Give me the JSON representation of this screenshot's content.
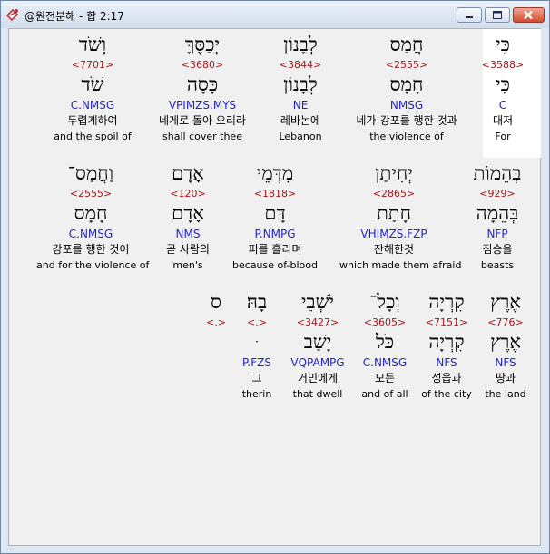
{
  "window": {
    "title": "@원전분해 - 합 2:17"
  },
  "rows": [
    [
      {
        "heb": "כִּי",
        "num": "<3588>",
        "lemma": "כִּי",
        "pars": "C",
        "kor": "대저",
        "eng": "For"
      },
      {
        "heb": "חֲמַס",
        "num": "<2555>",
        "lemma": "חָמָס",
        "pars": "NMSG",
        "kor": "네가-강포를 행한 것과",
        "eng": "the violence of"
      },
      {
        "heb": "לְבָנוֹן",
        "num": "<3844>",
        "lemma": "לְבָנוֹן",
        "pars": "NE",
        "kor": "레바논에",
        "eng": "Lebanon"
      },
      {
        "heb": "יְכַסֶּךָּ",
        "num": "<3680>",
        "lemma": "כָּסָה",
        "pars": "VPIMZS.MYS",
        "kor": "네게로 돌아 오리라",
        "eng": "shall cover thee"
      },
      {
        "heb": "וְשֹׁד",
        "num": "<7701>",
        "lemma": "שֹׁד",
        "pars": "C.NMSG",
        "kor": "두렵게하여",
        "eng": "and the spoil of"
      }
    ],
    [
      {
        "heb": "בְּהֵמוֹת",
        "num": "<929>",
        "lemma": "בְּהֵמָה",
        "pars": "NFP",
        "kor": "짐승을",
        "eng": "beasts"
      },
      {
        "heb": "יְחִיתַן",
        "num": "<2865>",
        "lemma": "חָתַת",
        "pars": "VHIMZS.FZP",
        "kor": "잔해한것",
        "eng": "which made them afraid"
      },
      {
        "heb": "מִדְּמֵי",
        "num": "<1818>",
        "lemma": "דָּם",
        "pars": "P.NMPG",
        "kor": "피를 흘리며",
        "eng": "because of-blood"
      },
      {
        "heb": "אָדָם",
        "num": "<120>",
        "lemma": "אָדָם",
        "pars": "NMS",
        "kor": "곧 사람의",
        "eng": "men's"
      },
      {
        "heb": "וַחֲמַס־",
        "num": "<2555>",
        "lemma": "חָמָס",
        "pars": "C.NMSG",
        "kor": "강포를 행한 것이",
        "eng": "and for the violence of"
      }
    ],
    [
      {
        "heb": "אֶרֶץ",
        "num": "<776>",
        "lemma": "אֶרֶץ",
        "pars": "NFS",
        "kor": "땅과",
        "eng": "the land"
      },
      {
        "heb": "קִרְיָה",
        "num": "<7151>",
        "lemma": "קִרְיָה",
        "pars": "NFS",
        "kor": "성읍과",
        "eng": "of the city"
      },
      {
        "heb": "וְכָל־",
        "num": "<3605>",
        "lemma": "כֹּל",
        "pars": "C.NMSG",
        "kor": "모든",
        "eng": "and of all"
      },
      {
        "heb": "יֹשְׁבֵי",
        "num": "<3427>",
        "lemma": "יָשַׁב",
        "pars": "VQPAMPG",
        "kor": "거민에게",
        "eng": "that dwell"
      },
      {
        "heb": "בָהּ׃",
        "num": "<.>",
        "lemma": "ּ",
        "pars": "P.FZS",
        "kor": "그",
        "eng": "therin"
      },
      {
        "heb": "ס",
        "num": "<.>",
        "lemma": "",
        "pars": "",
        "kor": "",
        "eng": ""
      }
    ]
  ]
}
